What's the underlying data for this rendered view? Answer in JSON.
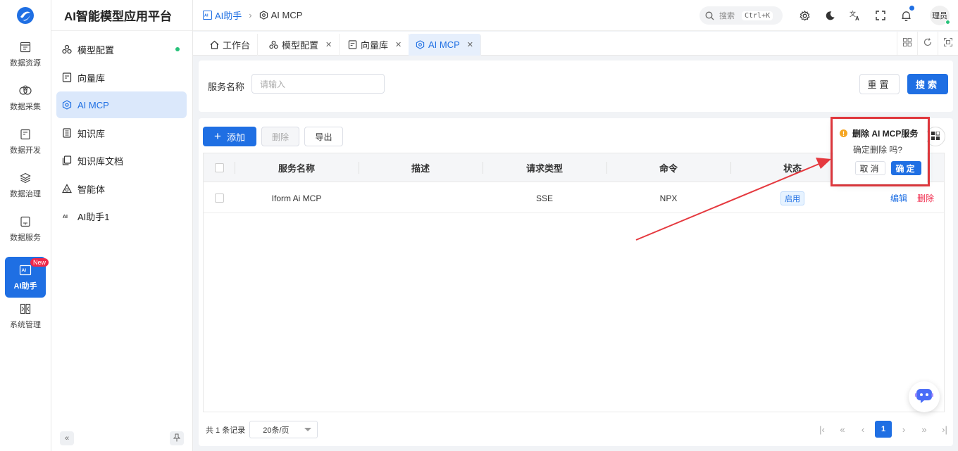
{
  "app": {
    "title": "AI智能模型应用平台"
  },
  "rail": {
    "items": [
      {
        "label": "数据资源",
        "icon": "table-icon"
      },
      {
        "label": "数据采集",
        "icon": "collect-icon"
      },
      {
        "label": "数据开发",
        "icon": "doc-icon"
      },
      {
        "label": "数据治理",
        "icon": "layers-icon"
      },
      {
        "label": "数据服务",
        "icon": "service-icon"
      },
      {
        "label": "AI助手",
        "icon": "ai-icon",
        "badge": "New",
        "active": true
      },
      {
        "label": "系统管理",
        "icon": "system-icon"
      }
    ]
  },
  "sidebar": {
    "items": [
      {
        "label": "模型配置",
        "icon": "model-icon"
      },
      {
        "label": "向量库",
        "icon": "vector-icon"
      },
      {
        "label": "AI MCP",
        "icon": "mcp-icon",
        "active": true
      },
      {
        "label": "知识库",
        "icon": "knowledge-icon"
      },
      {
        "label": "知识库文档",
        "icon": "knowledge-doc-icon"
      },
      {
        "label": "智能体",
        "icon": "agent-icon"
      },
      {
        "label": "AI助手1",
        "icon": "ai-text-icon"
      }
    ]
  },
  "header": {
    "breadcrumb": {
      "parent": "AI助手",
      "current": "AI MCP"
    },
    "search": {
      "placeholder": "搜索",
      "shortcut": "Ctrl+K"
    },
    "user": "理员"
  },
  "tabs": [
    {
      "label": "工作台",
      "closable": false
    },
    {
      "label": "模型配置",
      "closable": true
    },
    {
      "label": "向量库",
      "closable": true
    },
    {
      "label": "AI MCP",
      "closable": true,
      "active": true
    }
  ],
  "filter": {
    "label": "服务名称",
    "placeholder": "请输入",
    "reset": "重置",
    "search": "搜索"
  },
  "toolbar": {
    "add": "添加",
    "delete": "删除",
    "export": "导出"
  },
  "table": {
    "columns": [
      "服务名称",
      "描述",
      "请求类型",
      "命令",
      "状态"
    ],
    "rows": [
      {
        "name": "Iform Ai MCP",
        "desc": "",
        "type": "SSE",
        "command": "NPX",
        "status": "启用",
        "edit": "编辑",
        "delete": "删除"
      }
    ]
  },
  "pagination": {
    "total_text": "共 1 条记录",
    "page_size": "20条/页",
    "current_page": "1"
  },
  "popconfirm": {
    "title": "删除 AI MCP服务",
    "message": "确定删除 吗?",
    "cancel": "取消",
    "ok": "确定"
  },
  "colors": {
    "primary": "#1f6fe3",
    "danger": "#f0284a",
    "annotation": "#e5393f"
  }
}
